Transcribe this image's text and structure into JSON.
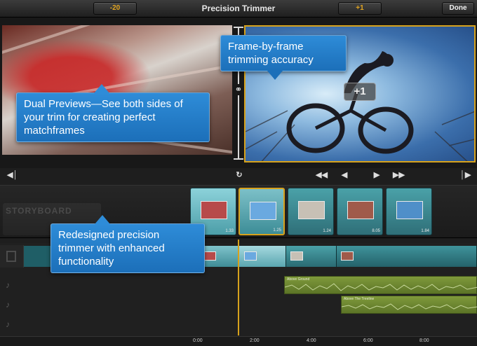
{
  "toolbar": {
    "left_offset": "-20",
    "title": "Precision Trimmer",
    "right_offset": "+1",
    "done_label": "Done"
  },
  "previews": {
    "right_badge": "+1"
  },
  "callouts": {
    "dual_previews": "Dual Previews—See both sides of your trim for creating perfect matchframes",
    "frame_accuracy": "Frame-by-frame trimming accuracy",
    "precision_trimmer": "Redesigned precision trimmer with enhanced functionality"
  },
  "transport": {
    "skip_back_icon": "skip-to-start-icon",
    "swap_icon": "swap-icon",
    "skip_end_icon": "skip-to-end-icon"
  },
  "storyboard": {
    "label": "STORYBOARD",
    "clips": [
      {
        "duration": "1.33",
        "thumb_color": "#b74a4a"
      },
      {
        "duration": "1.25",
        "thumb_color": "#6aa9e0"
      },
      {
        "duration": "1.24",
        "thumb_color": "#c7c0b5"
      },
      {
        "duration": "8.05",
        "thumb_color": "#a05a4a"
      },
      {
        "duration": "1.84",
        "thumb_color": "#4f8fc9"
      }
    ]
  },
  "timeline": {
    "audio_tracks": [
      {
        "label": "Above Ground"
      },
      {
        "label": "Above The Treeline"
      }
    ],
    "ruler": [
      "0:00",
      "2:00",
      "4:00",
      "6:00",
      "8:00"
    ]
  },
  "colors": {
    "accent": "#d7a21c",
    "callout": "#2480cc",
    "clip": "#4aa1a8",
    "audio": "#7f9a3b"
  }
}
